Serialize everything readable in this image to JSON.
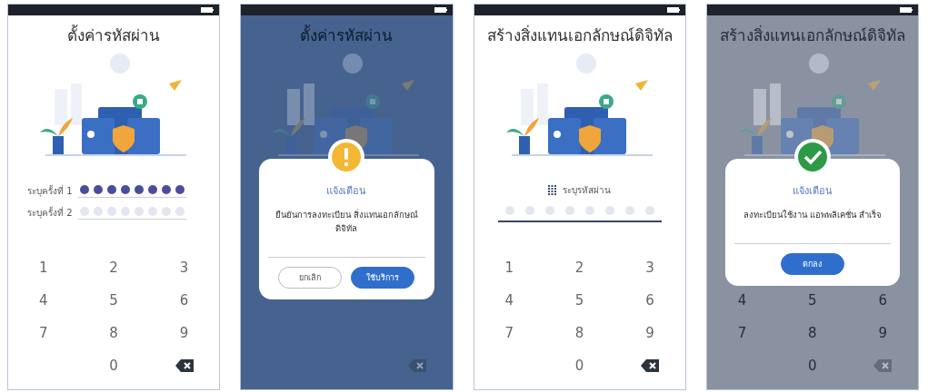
{
  "screens": [
    {
      "title": "ตั้งค่ารหัสผ่าน",
      "dimmed": false,
      "fields": [
        {
          "label": "ระบุครั้งที่ 1",
          "level": 1,
          "icon": false
        },
        {
          "label": "ระบุครั้งที่ 2",
          "level": 0,
          "icon": false
        }
      ],
      "keypad": [
        [
          {
            "kind": "digit",
            "label": "1"
          },
          {
            "kind": "digit",
            "label": "2"
          },
          {
            "kind": "digit",
            "label": "3"
          }
        ],
        [
          {
            "kind": "digit",
            "label": "4"
          },
          {
            "kind": "digit",
            "label": "5"
          },
          {
            "kind": "digit",
            "label": "6"
          }
        ],
        [
          {
            "kind": "digit",
            "label": "7"
          },
          {
            "kind": "digit",
            "label": "8"
          },
          {
            "kind": "digit",
            "label": "9"
          }
        ],
        [
          {
            "kind": "blank"
          },
          {
            "kind": "digit",
            "label": "0"
          },
          {
            "kind": "backspace"
          }
        ]
      ]
    },
    {
      "title": "ตั้งค่ารหัสผ่าน",
      "dimmed": true,
      "keypad": [
        [
          {
            "kind": "blank"
          },
          {
            "kind": "blank"
          },
          {
            "kind": "backspace"
          }
        ]
      ],
      "dialog": {
        "kind": "warning",
        "title": "แจ้งเตือน",
        "message": "ยืนยันการลงทะเบียน สิ่งแทนเอกลักษณ์ดิจิทัล",
        "buttons": [
          {
            "label": "ยกเลิก",
            "kind": "outline"
          },
          {
            "label": "ใช้บริการ",
            "kind": "primary"
          }
        ]
      }
    },
    {
      "title": "สร้างสิ่งแทนเอกลักษณ์ดิจิทัล",
      "dimmed": false,
      "fields": [
        {
          "label": "ระบุรหัสผ่าน",
          "level": 0,
          "icon": true
        }
      ],
      "keypad": [
        [
          {
            "kind": "digit",
            "label": "1"
          },
          {
            "kind": "digit",
            "label": "2"
          },
          {
            "kind": "digit",
            "label": "3"
          }
        ],
        [
          {
            "kind": "digit",
            "label": "4"
          },
          {
            "kind": "digit",
            "label": "5"
          },
          {
            "kind": "digit",
            "label": "6"
          }
        ],
        [
          {
            "kind": "digit",
            "label": "7"
          },
          {
            "kind": "digit",
            "label": "8"
          },
          {
            "kind": "digit",
            "label": "9"
          }
        ],
        [
          {
            "kind": "blank"
          },
          {
            "kind": "digit",
            "label": "0"
          },
          {
            "kind": "backspace"
          }
        ]
      ]
    },
    {
      "title": "สร้างสิ่งแทนเอกลักษณ์ดิจิทัล",
      "dimmed": true,
      "keypad": [
        [
          {
            "kind": "digit",
            "label": "4"
          },
          {
            "kind": "digit",
            "label": "5"
          },
          {
            "kind": "digit",
            "label": "6"
          }
        ],
        [
          {
            "kind": "digit",
            "label": "7"
          },
          {
            "kind": "digit",
            "label": "8"
          },
          {
            "kind": "digit",
            "label": "9"
          }
        ],
        [
          {
            "kind": "blank"
          },
          {
            "kind": "digit",
            "label": "0"
          },
          {
            "kind": "backspace"
          }
        ]
      ],
      "dialog": {
        "kind": "success",
        "title": "แจ้งเตือน",
        "message": "ลงทะเบียนใช้งาน แอพพลิเคชั่น สำเร็จ",
        "buttons": [
          {
            "label": "ตกลง",
            "kind": "primary"
          }
        ]
      }
    }
  ]
}
